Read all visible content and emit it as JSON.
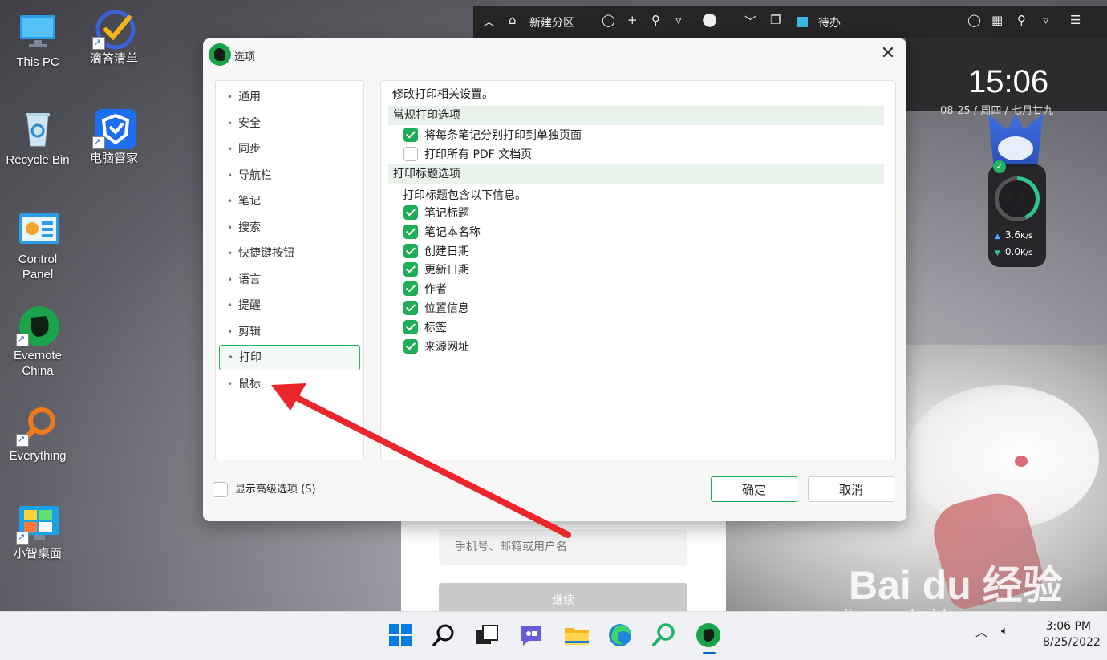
{
  "desktop": {
    "icons": [
      {
        "label": "This PC"
      },
      {
        "label": "滴答清单"
      },
      {
        "label": "Recycle Bin"
      },
      {
        "label": "电脑管家"
      },
      {
        "label": "Control\nPanel"
      },
      {
        "label": "Evernote\nChina"
      },
      {
        "label": "Everything"
      },
      {
        "label": "小智桌面"
      }
    ],
    "clock": "15:06",
    "date_partial": "08-25 / 周四 / 七月廿九"
  },
  "topbar": {
    "new_partition": "新建分区",
    "todo": "待办"
  },
  "widget": {
    "percent": "43",
    "percent_unit": "%",
    "up_speed": "3.6",
    "down_speed": "0.0",
    "speed_unit": "K/s"
  },
  "login": {
    "input_placeholder": "手机号、邮箱或用户名",
    "continue_label": "继续"
  },
  "dialog": {
    "title": "选项",
    "nav": [
      {
        "label": "通用",
        "active": false
      },
      {
        "label": "安全",
        "active": false
      },
      {
        "label": "同步",
        "active": false
      },
      {
        "label": "导航栏",
        "active": false
      },
      {
        "label": "笔记",
        "active": false
      },
      {
        "label": "搜索",
        "active": false
      },
      {
        "label": "快捷键按钮",
        "active": false
      },
      {
        "label": "语言",
        "active": false
      },
      {
        "label": "提醒",
        "active": false
      },
      {
        "label": "剪辑",
        "active": false
      },
      {
        "label": "打印",
        "active": true
      },
      {
        "label": "鼠标",
        "active": false
      }
    ],
    "content": {
      "description": "修改打印相关设置。",
      "general_section": "常规打印选项",
      "general_options": [
        {
          "label": "将每条笔记分别打印到单独页面",
          "checked": true
        },
        {
          "label": "打印所有 PDF 文档页",
          "checked": false
        }
      ],
      "header_section": "打印标题选项",
      "header_note": "打印标题包含以下信息。",
      "header_options": [
        {
          "label": "笔记标题",
          "checked": true
        },
        {
          "label": "笔记本名称",
          "checked": true
        },
        {
          "label": "创建日期",
          "checked": true
        },
        {
          "label": "更新日期",
          "checked": true
        },
        {
          "label": "作者",
          "checked": true
        },
        {
          "label": "位置信息",
          "checked": true
        },
        {
          "label": "标签",
          "checked": true
        },
        {
          "label": "来源网址",
          "checked": true
        }
      ]
    },
    "show_advanced": {
      "label": "显示高级选项 (S)",
      "checked": false
    },
    "ok_label": "确定",
    "cancel_label": "取消"
  },
  "taskbar": {
    "time": "3:06 PM",
    "date": "8/25/2022"
  },
  "watermark": {
    "brand": "Bai du 经验",
    "url": "jingyan.baidu.com"
  },
  "colors": {
    "accent_green": "#1fae57",
    "annotation_red": "#e8262b"
  }
}
